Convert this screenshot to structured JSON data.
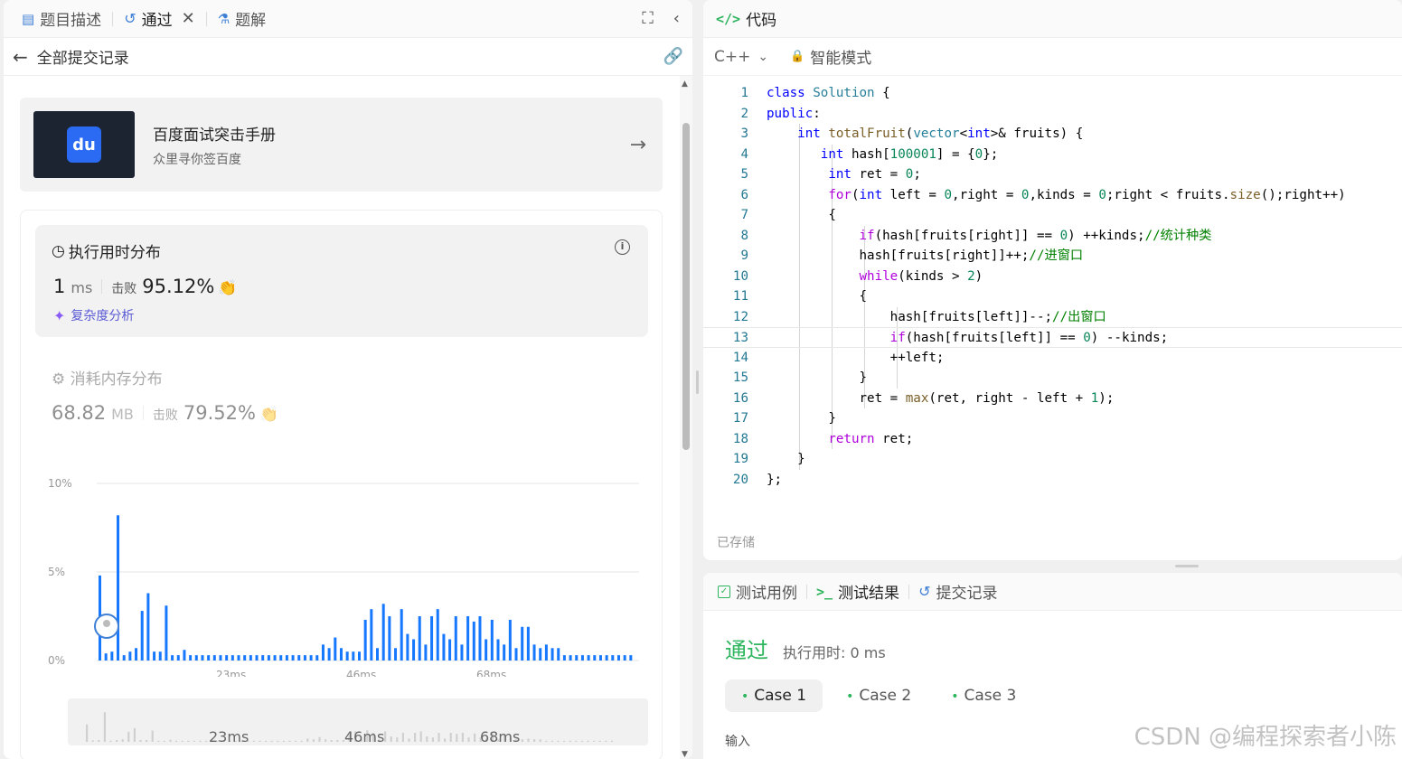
{
  "left_tabs": {
    "description": "题目描述",
    "passed": "通过",
    "solutions": "题解"
  },
  "subbar": {
    "back_label": "全部提交记录"
  },
  "ad": {
    "title": "百度面试突击手册",
    "subtitle": "众里寻你签百度",
    "logo_text": "du"
  },
  "runtime": {
    "heading": "执行用时分布",
    "value": "1",
    "unit": "ms",
    "beat_label": "击败",
    "beat_pct": "95.12%",
    "analysis": "复杂度分析"
  },
  "memory": {
    "heading": "消耗内存分布",
    "value": "68.82",
    "unit": "MB",
    "beat_label": "击败",
    "beat_pct": "79.52%"
  },
  "chart_data": {
    "type": "bar",
    "y_ticks": [
      "10%",
      "5%",
      "0%"
    ],
    "x_ticks": [
      "23ms",
      "46ms",
      "68ms"
    ],
    "ylim": [
      0,
      10
    ],
    "color": "#1677ff",
    "values": [
      4.8,
      0.4,
      0.5,
      8.2,
      0.3,
      0.5,
      0.7,
      2.8,
      3.8,
      0.5,
      0.5,
      3.1,
      0.3,
      0.3,
      0.6,
      0.3,
      0.3,
      0.3,
      0.3,
      0.3,
      0.3,
      0.3,
      0.3,
      0.3,
      0.3,
      0.3,
      0.3,
      0.3,
      0.3,
      0.3,
      0.3,
      0.3,
      0.3,
      0.3,
      0.3,
      0.3,
      0.3,
      0.9,
      0.7,
      1.3,
      0.7,
      0.5,
      0.5,
      0.5,
      2.3,
      2.9,
      0.7,
      3.2,
      2.5,
      0.7,
      2.9,
      1.5,
      1.2,
      2.5,
      0.9,
      2.5,
      2.9,
      1.5,
      1.2,
      2.5,
      0.9,
      2.5,
      2.2,
      2.5,
      1.2,
      2.3,
      1.2,
      0.9,
      2.3,
      0.7,
      1.9,
      1.9,
      0.9,
      0.7,
      0.9,
      0.7,
      0.7,
      0.3,
      0.3,
      0.3,
      0.3,
      0.3,
      0.3,
      0.3,
      0.3,
      0.3,
      0.3,
      0.3,
      0.3
    ],
    "mini_ticks": [
      "23ms",
      "46ms",
      "68ms"
    ]
  },
  "editor": {
    "tab_label": "代码",
    "language": "C++",
    "mode": "智能模式",
    "saved": "已存储",
    "lines": [
      "class Solution {",
      "public:",
      "    int totalFruit(vector<int>& fruits) {",
      "       int hash[100001] = {0};",
      "        int ret = 0;",
      "        for(int left = 0,right = 0,kinds = 0;right < fruits.size();right++)",
      "        {",
      "            if(hash[fruits[right]] == 0) ++kinds;//统计种类",
      "            hash[fruits[right]]++;//进窗口",
      "            while(kinds > 2)",
      "            {",
      "                hash[fruits[left]]--;//出窗口",
      "                if(hash[fruits[left]] == 0) --kinds;",
      "                ++left;",
      "            }",
      "            ret = max(ret, right - left + 1);",
      "        }",
      "        return ret;",
      "    }",
      "};"
    ]
  },
  "bottom_tabs": {
    "testcase": "测试用例",
    "result": "测试结果",
    "submissions": "提交记录"
  },
  "result": {
    "status": "通过",
    "runtime": "执行用时: 0 ms",
    "cases": [
      "Case 1",
      "Case 2",
      "Case 3"
    ],
    "input_label": "输入"
  },
  "watermark": "CSDN @编程探索者小陈"
}
